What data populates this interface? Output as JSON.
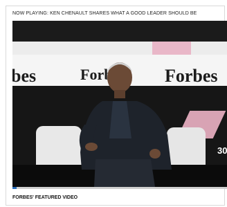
{
  "header": {
    "now_playing": "NOW PLAYING: KEN CHENAULT SHARES WHAT A GOOD LEADER SHOULD BE"
  },
  "video": {
    "brand_text": "Forbes",
    "brand_text_partial": "bes",
    "time_badge": "30",
    "progress_fraction": 0.02
  },
  "footer": {
    "featured_label": "FORBES' FEATURED VIDEO"
  },
  "colors": {
    "accent": "#2a6ebb",
    "brand_pink": "#e9b7c8"
  }
}
